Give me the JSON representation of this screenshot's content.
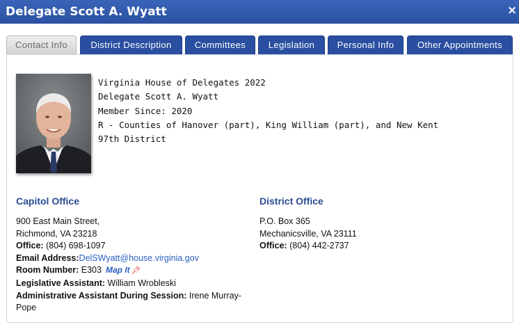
{
  "window": {
    "title": "Delegate Scott A. Wyatt",
    "close_glyph": "×"
  },
  "tabs": [
    {
      "label": "Contact Info",
      "active": true
    },
    {
      "label": "District Description",
      "active": false
    },
    {
      "label": "Committees",
      "active": false
    },
    {
      "label": "Legislation",
      "active": false
    },
    {
      "label": "Personal Info",
      "active": false
    },
    {
      "label": "Other Appointments",
      "active": false
    }
  ],
  "bio": {
    "line1": "Virginia House of Delegates 2022",
    "line2": "Delegate Scott A. Wyatt",
    "line3": "Member Since: 2020",
    "line4": "R - Counties of Hanover (part), King William (part), and New Kent",
    "line5": "97th District"
  },
  "capitol": {
    "heading": "Capitol Office",
    "street": "900 East Main Street,",
    "city": "Richmond, VA 23218",
    "office_label": "Office:",
    "office_phone": "(804) 698-1097",
    "email_label": "Email Address:",
    "email": "DelSWyatt@house.virginia.gov",
    "room_label": "Room Number:",
    "room": "E303",
    "map_label": "Map It",
    "la_label": "Legislative Assistant:",
    "la_name": "William Wrobleski",
    "aa_label": "Administrative Assistant During Session:",
    "aa_name_1": "Irene Murray-",
    "aa_name_2": "Pope"
  },
  "district": {
    "heading": "District Office",
    "po": "P.O. Box 365",
    "city": "Mechanicsville, VA 23111",
    "office_label": "Office:",
    "office_phone": "(804) 442-2737"
  },
  "colors": {
    "titlebar": "#2f57aa",
    "tab": "#2a4fa0",
    "heading": "#2c4c93",
    "link": "#2c5ec2"
  }
}
